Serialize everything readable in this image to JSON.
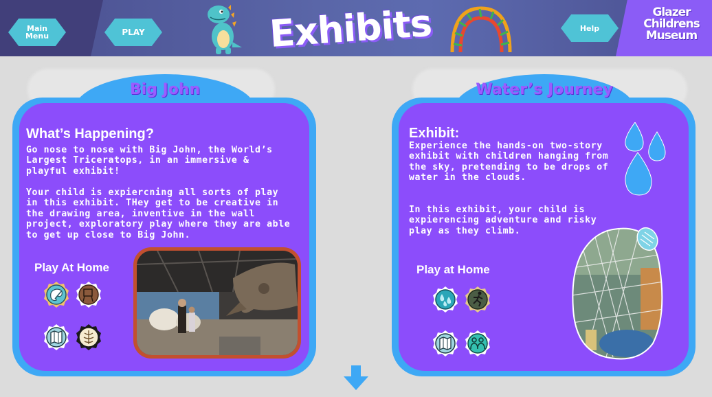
{
  "header": {
    "main_menu_label": "Main\nMenu",
    "play_label": "PLAY",
    "title": "Exhibits",
    "help_label": "Help",
    "brand_lines": [
      "Glazer",
      "Childrens",
      "Museum"
    ]
  },
  "left_panel": {
    "title": "Big John",
    "heading": "What’s Happening?",
    "paragraph1": "Go nose to nose with Big John, the World’s Largest Triceratops, in an immersive & playful exhibit!",
    "paragraph2": "Your child is expiercning all sorts of play in this exhibit. THey get to be creative in the drawing area, inventive in the wall project, exploratory play where they are able to get up close to Big John.",
    "play_home": "Play At Home",
    "icons": [
      "art-palette-icon",
      "easel-icon",
      "map-icon",
      "brain-icon"
    ]
  },
  "right_panel": {
    "title": "Water’s Journey",
    "heading": "Exhibit:",
    "paragraph1": "Experience the hands-on two-story exhibit with children hanging from the sky, pretending to be drops of water in the clouds.",
    "paragraph2": "In this exhibit, your child is expierencing adventure and risky play as they climb.",
    "play_home": "Play at Home",
    "icons": [
      "water-drops-icon",
      "runner-icon",
      "map-icon",
      "people-icon"
    ]
  },
  "colors": {
    "header": "#5a66a8",
    "panel_border": "#3ea8f5",
    "panel_fill": "#8c4dfb",
    "button": "#4fc3d6",
    "accent": "#9a5cff"
  }
}
